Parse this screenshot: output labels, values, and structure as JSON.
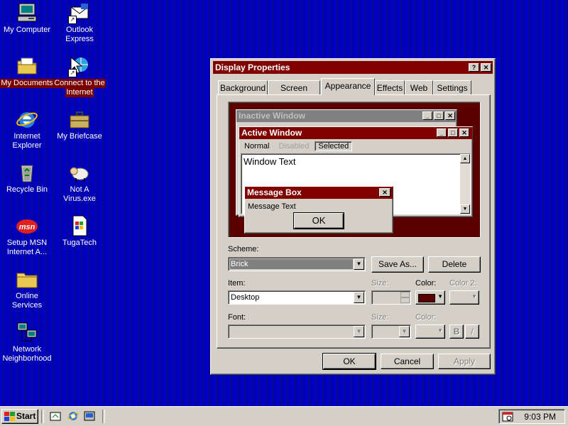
{
  "desktop": {
    "icons_left": [
      {
        "label_1": "My Computer",
        "label_2": ""
      },
      {
        "label_1": "My Documents",
        "label_2": ""
      },
      {
        "label_1": "Internet",
        "label_2": "Explorer"
      },
      {
        "label_1": "Recycle Bin",
        "label_2": ""
      },
      {
        "label_1": "Setup MSN",
        "label_2": "Internet A..."
      },
      {
        "label_1": "Online",
        "label_2": "Services"
      },
      {
        "label_1": "Network",
        "label_2": "Neighborhood"
      }
    ],
    "icons_right": [
      {
        "label_1": "Outlook",
        "label_2": "Express"
      },
      {
        "label_1": "Connect to the",
        "label_2": "Internet"
      },
      {
        "label_1": "My Briefcase",
        "label_2": ""
      },
      {
        "label_1": "Not A",
        "label_2": "Virus.exe"
      },
      {
        "label_1": "TugaTech",
        "label_2": ""
      }
    ]
  },
  "dialog": {
    "title": "Display Properties",
    "help_glyph": "?",
    "close_glyph": "✕",
    "tabs": [
      "Background",
      "Screen Saver",
      "Appearance",
      "Effects",
      "Web",
      "Settings"
    ],
    "active_tab": "Appearance",
    "preview": {
      "inactive_title": "Inactive Window",
      "active_title": "Active Window",
      "menu": {
        "normal": "Normal",
        "disabled": "Disabled",
        "selected": "Selected"
      },
      "window_text": "Window Text",
      "message_title": "Message Box",
      "message_text": "Message Text",
      "ok": "OK"
    },
    "scheme_label": "Scheme:",
    "scheme_value": "Brick",
    "save_as": "Save As...",
    "delete": "Delete",
    "item_label": "Item:",
    "item_value": "Desktop",
    "size_label": "Size:",
    "color_label": "Color:",
    "color2_label": "Color 2:",
    "font_label": "Font:",
    "font_size_label": "Size:",
    "font_color_label": "Color:",
    "bold": "B",
    "italic": "/",
    "ok": "OK",
    "cancel": "Cancel",
    "apply": "Apply",
    "desktop_color": "#5a0000"
  },
  "taskbar": {
    "start": "Start",
    "clock": "9:03 PM"
  },
  "colors": {
    "title_active": "#800000",
    "title_inactive": "#808080",
    "face": "#d4d0c8"
  }
}
